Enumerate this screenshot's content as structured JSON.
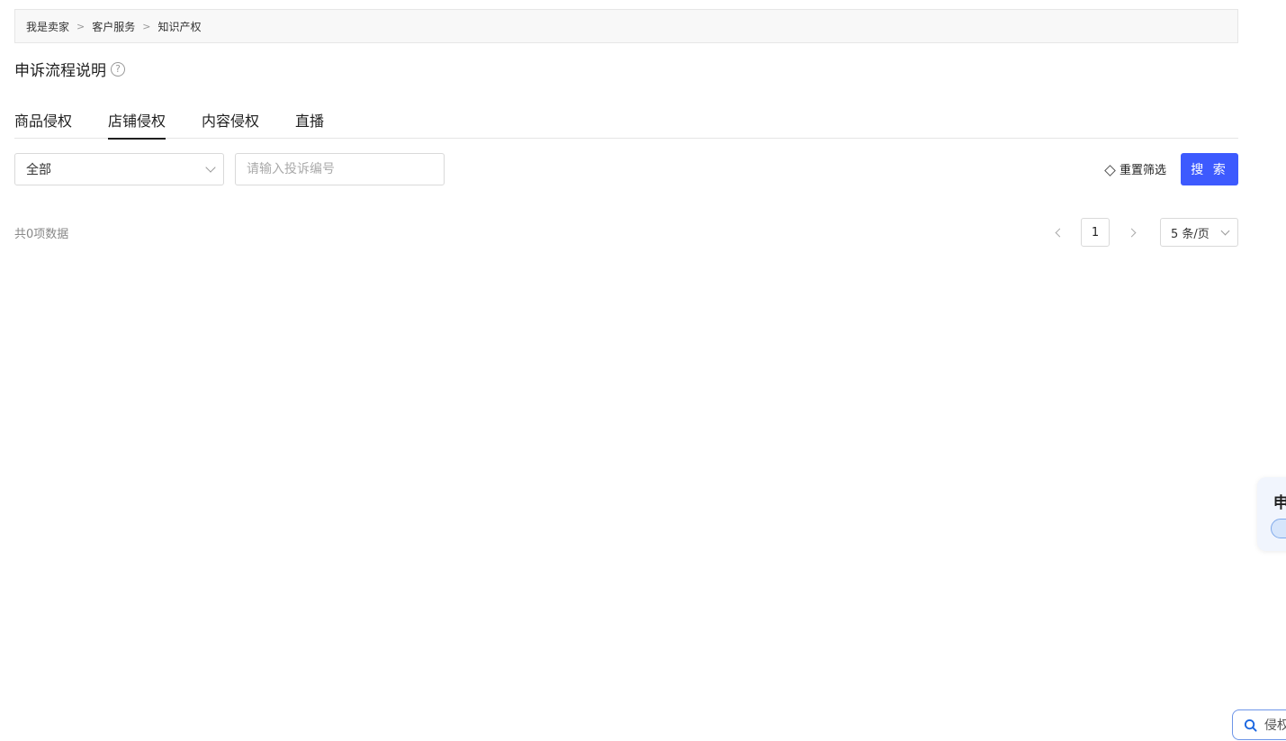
{
  "breadcrumb": {
    "items": [
      "我是卖家",
      "客户服务",
      "知识产权"
    ],
    "separator": ">"
  },
  "page": {
    "title": "申诉流程说明",
    "help_icon": "question-circle-icon"
  },
  "tabs": [
    {
      "label": "商品侵权",
      "active": false
    },
    {
      "label": "店铺侵权",
      "active": true
    },
    {
      "label": "内容侵权",
      "active": false
    },
    {
      "label": "直播",
      "active": false
    }
  ],
  "filters": {
    "status_select": {
      "selected": "全部"
    },
    "complaint_input": {
      "value": "",
      "placeholder": "请输入投诉编号"
    },
    "reset_label": "重置筛选",
    "search_label": "搜 索"
  },
  "results": {
    "total_text": "共0项数据",
    "current_page": "1",
    "page_size": "5 条/页"
  },
  "floating": {
    "card_text": "申",
    "search_text": "侵权"
  },
  "colors": {
    "primary": "#3d5afe",
    "float_card_bg": "#f1f5fd",
    "float_border": "#6d95e8"
  }
}
